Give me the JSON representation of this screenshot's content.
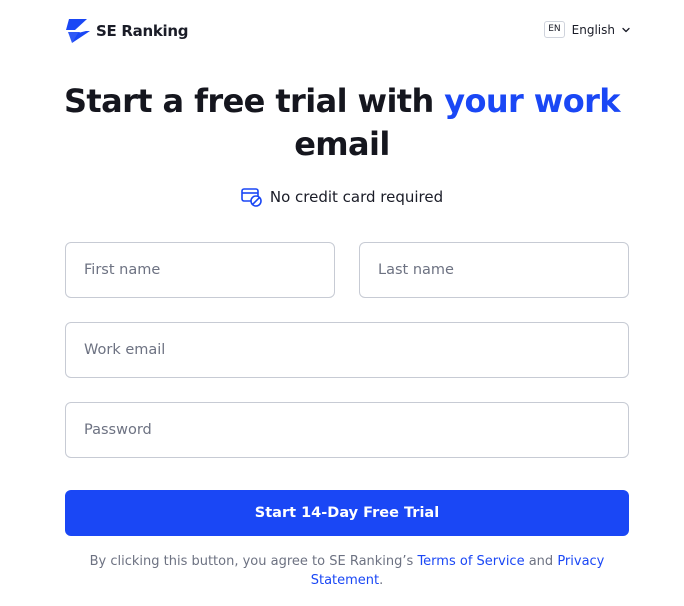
{
  "header": {
    "logo_text": "SE Ranking",
    "language": {
      "code": "EN",
      "label": "English"
    }
  },
  "title": {
    "part1": "Start a free trial with ",
    "accent": "your work",
    "part2": "email"
  },
  "subtitle": "No credit card required",
  "form": {
    "first_name_placeholder": "First name",
    "last_name_placeholder": "Last name",
    "email_placeholder": "Work email",
    "password_placeholder": "Password",
    "submit_label": "Start 14-Day Free Trial"
  },
  "legal": {
    "prefix": "By clicking this button, you agree to SE Ranking’s ",
    "terms": "Terms of Service",
    "and": " and ",
    "privacy": "Privacy Statement",
    "suffix": "."
  },
  "colors": {
    "accent": "#1a47f5",
    "text": "#1a1c27",
    "muted": "#6d7282"
  },
  "icons": {
    "logo": "se-ranking-logo-icon",
    "chevron": "chevron-down-icon",
    "no_card": "credit-card-off-icon"
  }
}
